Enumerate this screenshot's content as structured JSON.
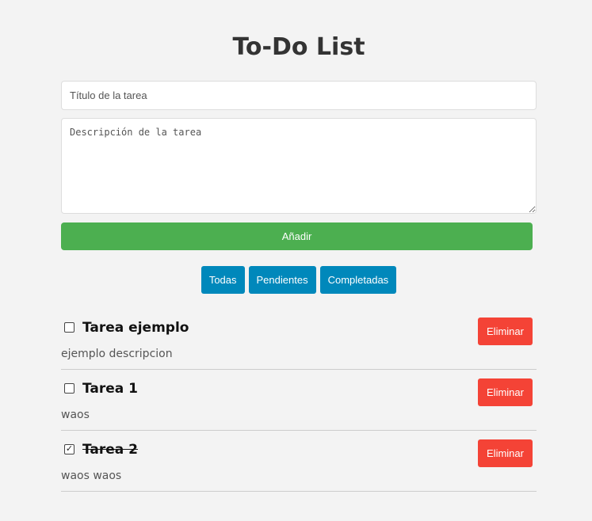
{
  "app": {
    "title": "To-Do List"
  },
  "form": {
    "title_placeholder": "Título de la tarea",
    "title_value": "",
    "description_placeholder": "Descripción de la tarea",
    "description_value": "",
    "add_label": "Añadir"
  },
  "filters": {
    "all_label": "Todas",
    "pending_label": "Pendientes",
    "completed_label": "Completadas"
  },
  "tasks": [
    {
      "title": "Tarea ejemplo",
      "description": "ejemplo descripcion",
      "completed": false,
      "delete_label": "Eliminar"
    },
    {
      "title": "Tarea 1",
      "description": "waos",
      "completed": false,
      "delete_label": "Eliminar"
    },
    {
      "title": "Tarea 2",
      "description": "waos waos",
      "completed": true,
      "delete_label": "Eliminar"
    }
  ],
  "colors": {
    "background": "#f3f3f3",
    "add_button": "#4caf50",
    "filter_button": "#0088bb",
    "delete_button": "#f44336"
  },
  "icons": {
    "checked": "☑",
    "unchecked": "☐"
  }
}
